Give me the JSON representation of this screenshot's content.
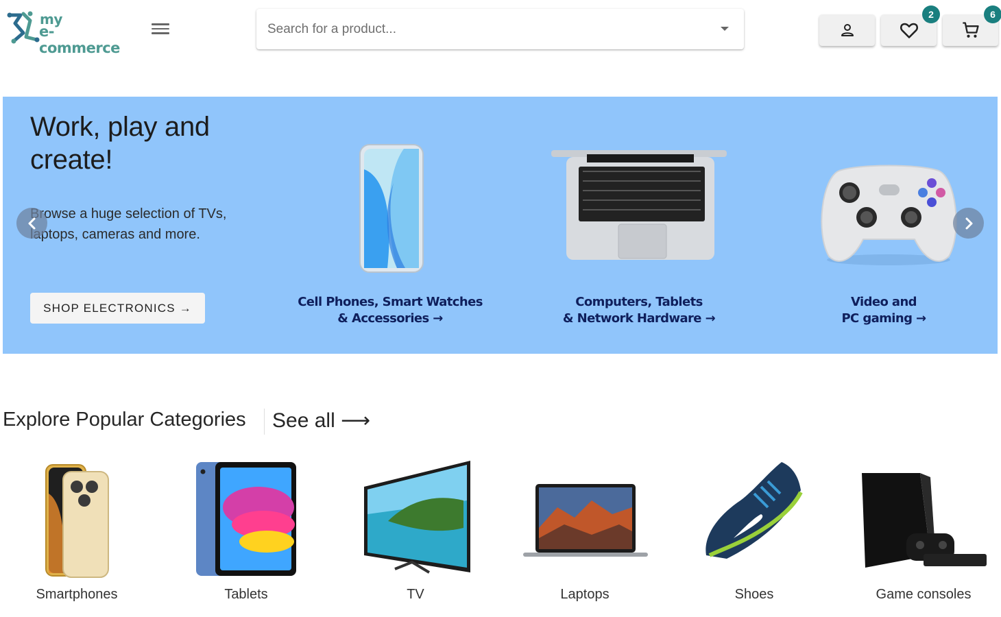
{
  "header": {
    "logo": {
      "line1": "my",
      "line2": "e-commerce"
    },
    "search": {
      "placeholder": "Search for a product..."
    },
    "wishlist_count": "2",
    "cart_count": "6"
  },
  "hero": {
    "title": "Work, play and create!",
    "subtitle": "Browse a huge selection of TVs, laptops, cameras and more.",
    "cta_label": "SHOP ELECTRONICS →",
    "categories": [
      {
        "line1": "Cell Phones, Smart Watches",
        "line2": "& Accessories →"
      },
      {
        "line1": "Computers, Tablets",
        "line2": "& Network Hardware →"
      },
      {
        "line1": "Video and",
        "line2": "PC gaming →"
      }
    ]
  },
  "categories": {
    "heading": "Explore Popular Categories",
    "see_all": "See all ⟶",
    "items": [
      {
        "label": "Smartphones"
      },
      {
        "label": "Tablets"
      },
      {
        "label": "TV"
      },
      {
        "label": "Laptops"
      },
      {
        "label": "Shoes"
      },
      {
        "label": "Game consoles"
      }
    ]
  },
  "colors": {
    "brand": "#4e9a92",
    "hero_bg": "#90c5fb",
    "badge": "#1a7f7f",
    "hero_link": "#0f1f5c"
  }
}
